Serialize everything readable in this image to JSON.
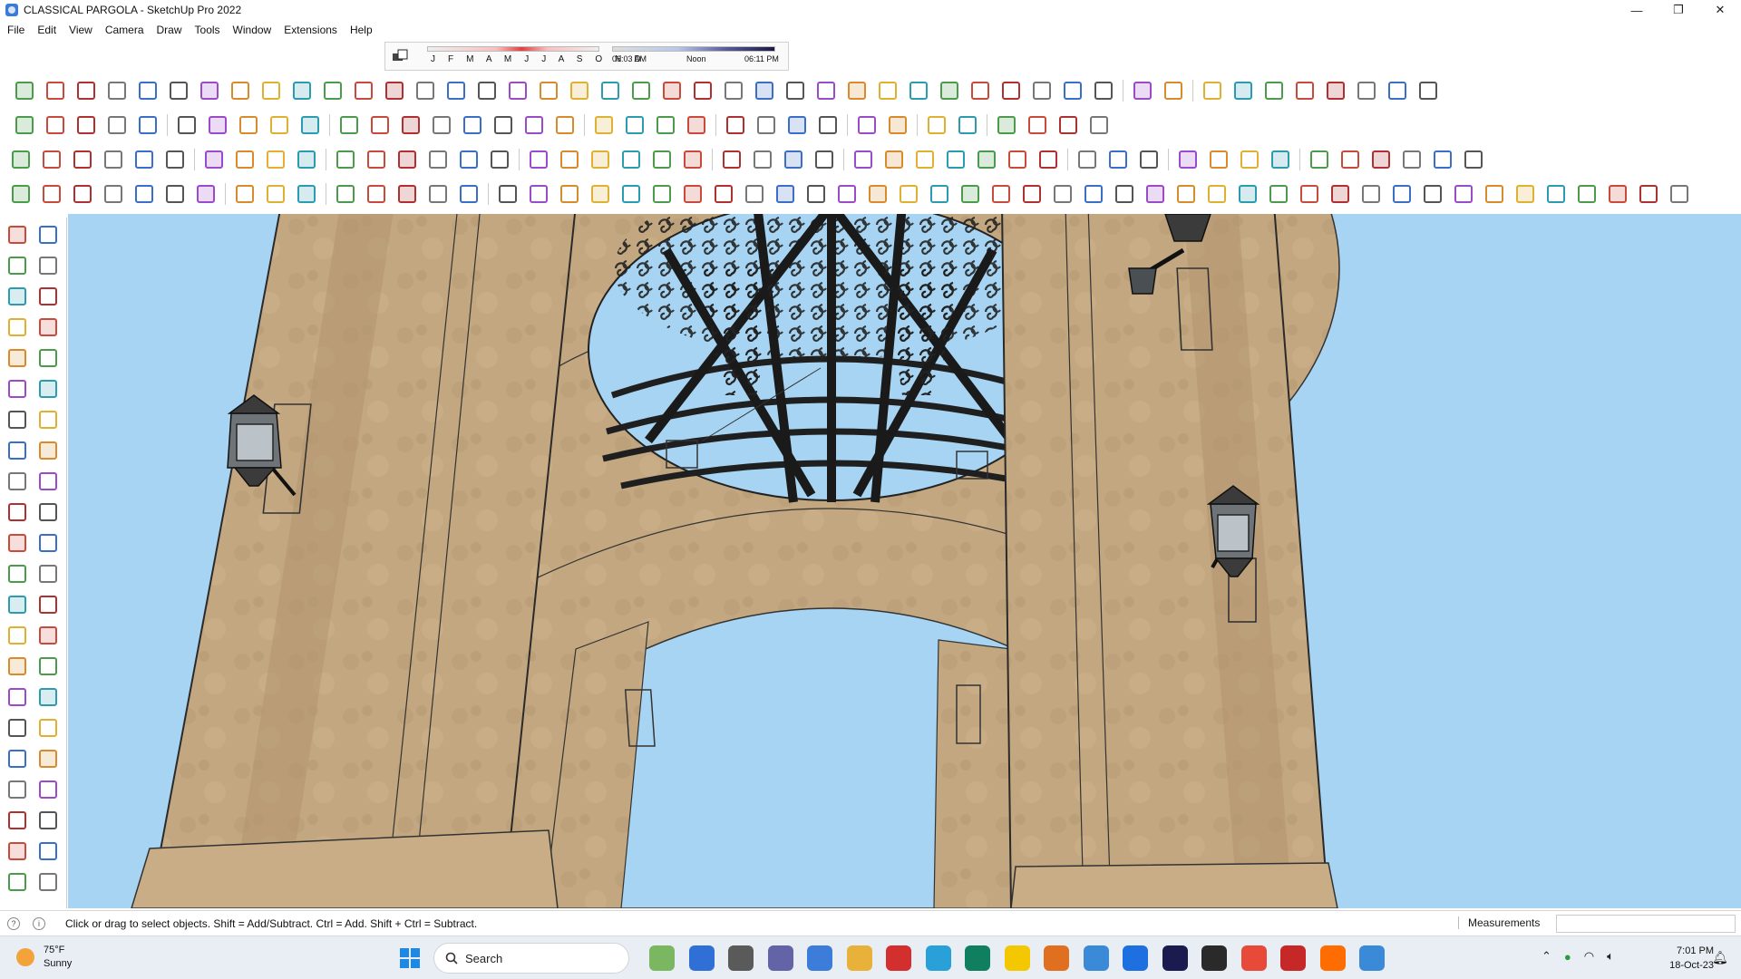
{
  "window": {
    "title": "CLASSICAL PARGOLA - SketchUp Pro 2022",
    "minimize": "—",
    "restore": "❐",
    "close": "✕"
  },
  "menu": [
    "File",
    "Edit",
    "View",
    "Camera",
    "Draw",
    "Tools",
    "Window",
    "Extensions",
    "Help"
  ],
  "shadows": {
    "months": "J F M A M J J A S O N D",
    "time_start": "06:03 AM",
    "time_mid": "Noon",
    "time_end": "06:11 PM"
  },
  "status": {
    "hint": "Click or drag to select objects. Shift = Add/Subtract. Ctrl = Add. Shift + Ctrl = Subtract.",
    "measurements_label": "Measurements",
    "measurements_value": ""
  },
  "taskbar": {
    "weather_temp": "75°F",
    "weather_desc": "Sunny",
    "search_placeholder": "Search",
    "time": "7:01 PM",
    "date": "18-Oct-23"
  },
  "colors": {
    "sky": "#a6d4f2",
    "stone": "#c4a882",
    "stone_dark": "#a58a66",
    "iron": "#2a2a2a"
  }
}
